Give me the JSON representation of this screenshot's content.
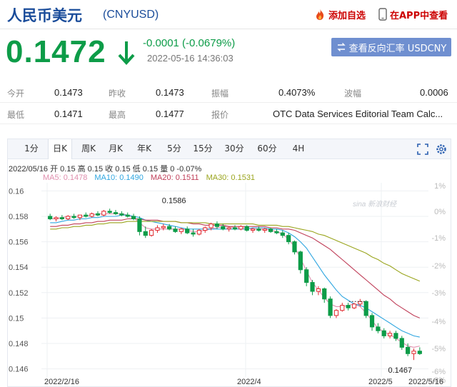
{
  "header": {
    "title": "人民币美元",
    "code": "(CNYUSD)",
    "favorite_label": "添加自选",
    "app_label": "在APP中查看"
  },
  "quote": {
    "price": "0.1472",
    "change": "-0.0001 (-0.0679%)",
    "time": "2022-05-16 14:36:03",
    "reverse_label": "查看反向汇率 USDCNY"
  },
  "stats": {
    "open_label": "今开",
    "open": "0.1473",
    "prev_close_label": "昨收",
    "prev_close": "0.1473",
    "amplitude_label": "振幅",
    "amplitude": "0.4073%",
    "wave_label": "波幅",
    "wave": "0.0006",
    "low_label": "最低",
    "low": "0.1471",
    "high_label": "最高",
    "high": "0.1477",
    "quote_label": "报价",
    "quote_source": "OTC Data Services Editorial Team Calc..."
  },
  "chart_tabs": [
    {
      "label": "1分",
      "active": false
    },
    {
      "label": "日K",
      "active": true
    },
    {
      "label": "周K",
      "active": false
    },
    {
      "label": "月K",
      "active": false
    },
    {
      "label": "年K",
      "active": false
    },
    {
      "label": "5分",
      "active": false
    },
    {
      "label": "15分",
      "active": false
    },
    {
      "label": "30分",
      "active": false
    },
    {
      "label": "60分",
      "active": false
    },
    {
      "label": "4H",
      "active": false
    }
  ],
  "info_line": "2022/05/16 开 0.15 高 0.15 收 0.15 低 0.15 量 0 -0.07%",
  "ma_legend": [
    {
      "label": "MA5: 0.1478",
      "color": "#e08fae"
    },
    {
      "label": "MA10: 0.1490",
      "color": "#2fa6e0"
    },
    {
      "label": "MA20: 0.1511",
      "color": "#c0405a"
    },
    {
      "label": "MA30: 0.1531",
      "color": "#9aa51e"
    }
  ],
  "watermark": "sina 新浪财经",
  "colors": {
    "accent": "#1a4c9a",
    "down": "#0d9c48",
    "up": "#e0282e",
    "button": "#6f8fd0"
  },
  "icons": {
    "favorite": "fire-icon",
    "app": "phone-icon",
    "reverse": "swap-icon",
    "fullscreen": "fullscreen-icon",
    "settings": "settings-icon"
  },
  "chart_data": {
    "type": "candlestick",
    "y_ticks": [
      "0.16",
      "0.158",
      "0.156",
      "0.154",
      "0.152",
      "0.15",
      "0.148",
      "0.146"
    ],
    "y_right_ticks": [
      "1%",
      "0%",
      "-1%",
      "-2%",
      "-3%",
      "-4%",
      "-5%",
      "-6%",
      "-8%"
    ],
    "x_labels": [
      "2022/2/16",
      "2022/4",
      "2022/5",
      "2022/5/16"
    ],
    "ylim": [
      0.1457,
      0.1603
    ],
    "annotations": [
      {
        "label": "0.1586",
        "index": 19,
        "value": 0.1586
      },
      {
        "label": "0.1467",
        "index": 61,
        "value": 0.1467
      }
    ],
    "candles": [
      {
        "o": 0.158,
        "h": 0.1582,
        "l": 0.1577,
        "c": 0.1578
      },
      {
        "o": 0.1578,
        "h": 0.158,
        "l": 0.1576,
        "c": 0.1579
      },
      {
        "o": 0.1579,
        "h": 0.1581,
        "l": 0.1577,
        "c": 0.1578
      },
      {
        "o": 0.1578,
        "h": 0.1581,
        "l": 0.1577,
        "c": 0.158
      },
      {
        "o": 0.158,
        "h": 0.1582,
        "l": 0.1578,
        "c": 0.1579
      },
      {
        "o": 0.1579,
        "h": 0.1581,
        "l": 0.1577,
        "c": 0.1581
      },
      {
        "o": 0.1581,
        "h": 0.1583,
        "l": 0.1579,
        "c": 0.158
      },
      {
        "o": 0.158,
        "h": 0.1583,
        "l": 0.1579,
        "c": 0.1582
      },
      {
        "o": 0.1582,
        "h": 0.1584,
        "l": 0.158,
        "c": 0.1581
      },
      {
        "o": 0.1581,
        "h": 0.1585,
        "l": 0.158,
        "c": 0.1584
      },
      {
        "o": 0.1584,
        "h": 0.1586,
        "l": 0.1582,
        "c": 0.1583
      },
      {
        "o": 0.1583,
        "h": 0.1585,
        "l": 0.1581,
        "c": 0.1582
      },
      {
        "o": 0.1582,
        "h": 0.1584,
        "l": 0.158,
        "c": 0.1581
      },
      {
        "o": 0.1581,
        "h": 0.1583,
        "l": 0.1579,
        "c": 0.158
      },
      {
        "o": 0.158,
        "h": 0.1582,
        "l": 0.1577,
        "c": 0.1578
      },
      {
        "o": 0.1578,
        "h": 0.158,
        "l": 0.1565,
        "c": 0.1568
      },
      {
        "o": 0.1568,
        "h": 0.1572,
        "l": 0.1563,
        "c": 0.1565
      },
      {
        "o": 0.1565,
        "h": 0.157,
        "l": 0.1564,
        "c": 0.1569
      },
      {
        "o": 0.1569,
        "h": 0.1573,
        "l": 0.1567,
        "c": 0.1571
      },
      {
        "o": 0.1571,
        "h": 0.1574,
        "l": 0.1569,
        "c": 0.1572
      },
      {
        "o": 0.1572,
        "h": 0.1574,
        "l": 0.1569,
        "c": 0.157
      },
      {
        "o": 0.157,
        "h": 0.1572,
        "l": 0.1567,
        "c": 0.1568
      },
      {
        "o": 0.1568,
        "h": 0.1571,
        "l": 0.1566,
        "c": 0.157
      },
      {
        "o": 0.157,
        "h": 0.1572,
        "l": 0.1566,
        "c": 0.1567
      },
      {
        "o": 0.1567,
        "h": 0.157,
        "l": 0.1564,
        "c": 0.1566
      },
      {
        "o": 0.1566,
        "h": 0.157,
        "l": 0.1565,
        "c": 0.1569
      },
      {
        "o": 0.1569,
        "h": 0.1572,
        "l": 0.1567,
        "c": 0.1571
      },
      {
        "o": 0.1571,
        "h": 0.1575,
        "l": 0.1569,
        "c": 0.1574
      },
      {
        "o": 0.1574,
        "h": 0.1576,
        "l": 0.157,
        "c": 0.1572
      },
      {
        "o": 0.1572,
        "h": 0.1574,
        "l": 0.1569,
        "c": 0.157
      },
      {
        "o": 0.157,
        "h": 0.1572,
        "l": 0.1568,
        "c": 0.1571
      },
      {
        "o": 0.1571,
        "h": 0.1573,
        "l": 0.1569,
        "c": 0.157
      },
      {
        "o": 0.157,
        "h": 0.1573,
        "l": 0.1569,
        "c": 0.1572
      },
      {
        "o": 0.1572,
        "h": 0.1573,
        "l": 0.1568,
        "c": 0.1569
      },
      {
        "o": 0.1569,
        "h": 0.1571,
        "l": 0.1567,
        "c": 0.157
      },
      {
        "o": 0.157,
        "h": 0.1572,
        "l": 0.1568,
        "c": 0.1569
      },
      {
        "o": 0.1569,
        "h": 0.1571,
        "l": 0.1567,
        "c": 0.157
      },
      {
        "o": 0.157,
        "h": 0.1571,
        "l": 0.1567,
        "c": 0.1568
      },
      {
        "o": 0.1568,
        "h": 0.157,
        "l": 0.1566,
        "c": 0.1567
      },
      {
        "o": 0.1567,
        "h": 0.1569,
        "l": 0.1563,
        "c": 0.1565
      },
      {
        "o": 0.1565,
        "h": 0.1567,
        "l": 0.1558,
        "c": 0.156
      },
      {
        "o": 0.156,
        "h": 0.1561,
        "l": 0.155,
        "c": 0.1552
      },
      {
        "o": 0.1552,
        "h": 0.1553,
        "l": 0.1535,
        "c": 0.1538
      },
      {
        "o": 0.1538,
        "h": 0.154,
        "l": 0.1525,
        "c": 0.1528
      },
      {
        "o": 0.1528,
        "h": 0.153,
        "l": 0.1518,
        "c": 0.1521
      },
      {
        "o": 0.1521,
        "h": 0.1525,
        "l": 0.1518,
        "c": 0.1523
      },
      {
        "o": 0.1523,
        "h": 0.1524,
        "l": 0.1512,
        "c": 0.1515
      },
      {
        "o": 0.1515,
        "h": 0.1517,
        "l": 0.15,
        "c": 0.1502
      },
      {
        "o": 0.1502,
        "h": 0.1507,
        "l": 0.15,
        "c": 0.1506
      },
      {
        "o": 0.1506,
        "h": 0.1512,
        "l": 0.1505,
        "c": 0.151
      },
      {
        "o": 0.151,
        "h": 0.1512,
        "l": 0.1506,
        "c": 0.1508
      },
      {
        "o": 0.1508,
        "h": 0.1512,
        "l": 0.1507,
        "c": 0.1511
      },
      {
        "o": 0.1511,
        "h": 0.1515,
        "l": 0.1509,
        "c": 0.1513
      },
      {
        "o": 0.1513,
        "h": 0.1514,
        "l": 0.15,
        "c": 0.1502
      },
      {
        "o": 0.1502,
        "h": 0.1504,
        "l": 0.149,
        "c": 0.1493
      },
      {
        "o": 0.1493,
        "h": 0.1496,
        "l": 0.1488,
        "c": 0.149
      },
      {
        "o": 0.149,
        "h": 0.1492,
        "l": 0.1484,
        "c": 0.1486
      },
      {
        "o": 0.1486,
        "h": 0.149,
        "l": 0.1484,
        "c": 0.1488
      },
      {
        "o": 0.1488,
        "h": 0.149,
        "l": 0.1482,
        "c": 0.1484
      },
      {
        "o": 0.1484,
        "h": 0.1486,
        "l": 0.1475,
        "c": 0.1477
      },
      {
        "o": 0.1477,
        "h": 0.148,
        "l": 0.147,
        "c": 0.1472
      },
      {
        "o": 0.1472,
        "h": 0.1476,
        "l": 0.1467,
        "c": 0.1474
      },
      {
        "o": 0.1474,
        "h": 0.1477,
        "l": 0.1471,
        "c": 0.1472
      }
    ],
    "ma": [
      {
        "name": "MA5",
        "color": "#e08fae",
        "values": [
          0.1578,
          0.1578,
          0.1579,
          0.158,
          0.158,
          0.158,
          0.158,
          0.1581,
          0.1582,
          0.1582,
          0.1582,
          0.1582,
          0.1582,
          0.1581,
          0.1579,
          0.1575,
          0.1571,
          0.157,
          0.157,
          0.157,
          0.157,
          0.157,
          0.157,
          0.1569,
          0.1568,
          0.1568,
          0.1569,
          0.157,
          0.1571,
          0.1572,
          0.1572,
          0.1571,
          0.1571,
          0.1571,
          0.157,
          0.157,
          0.157,
          0.1569,
          0.1568,
          0.1566,
          0.1562,
          0.1556,
          0.1547,
          0.1537,
          0.1528,
          0.1522,
          0.1516,
          0.1511,
          0.1509,
          0.1509,
          0.151,
          0.1511,
          0.1509,
          0.1504,
          0.1498,
          0.1492,
          0.1489,
          0.1487,
          0.1484,
          0.1481,
          0.1478,
          0.1477,
          0.1478
        ]
      },
      {
        "name": "MA10",
        "color": "#2fa6e0",
        "values": [
          0.1575,
          0.1575,
          0.1576,
          0.1577,
          0.1577,
          0.1578,
          0.1578,
          0.1579,
          0.1579,
          0.158,
          0.158,
          0.158,
          0.1581,
          0.1581,
          0.158,
          0.1579,
          0.1577,
          0.1576,
          0.1575,
          0.1574,
          0.1573,
          0.1572,
          0.1571,
          0.157,
          0.157,
          0.157,
          0.157,
          0.157,
          0.157,
          0.157,
          0.157,
          0.157,
          0.157,
          0.157,
          0.1571,
          0.1571,
          0.1571,
          0.157,
          0.157,
          0.1569,
          0.1567,
          0.1564,
          0.156,
          0.1555,
          0.1548,
          0.1541,
          0.1534,
          0.1528,
          0.1522,
          0.1517,
          0.1514,
          0.1511,
          0.151,
          0.1508,
          0.1505,
          0.1502,
          0.1499,
          0.1496,
          0.1493,
          0.149,
          0.1488,
          0.1486,
          0.1485
        ]
      },
      {
        "name": "MA20",
        "color": "#c0405a",
        "values": [
          0.1572,
          0.1572,
          0.1573,
          0.1573,
          0.1574,
          0.1574,
          0.1575,
          0.1575,
          0.1576,
          0.1576,
          0.1577,
          0.1577,
          0.1577,
          0.1578,
          0.1578,
          0.1578,
          0.1577,
          0.1577,
          0.1577,
          0.1576,
          0.1576,
          0.1576,
          0.1575,
          0.1575,
          0.1574,
          0.1574,
          0.1573,
          0.1573,
          0.1573,
          0.1573,
          0.1572,
          0.1572,
          0.1572,
          0.1572,
          0.1572,
          0.1572,
          0.1572,
          0.1571,
          0.1571,
          0.157,
          0.157,
          0.1569,
          0.1567,
          0.1565,
          0.1563,
          0.156,
          0.1557,
          0.1554,
          0.155,
          0.1546,
          0.1542,
          0.1538,
          0.1534,
          0.153,
          0.1526,
          0.1522,
          0.1518,
          0.1515,
          0.1511,
          0.1508,
          0.1505,
          0.1502,
          0.15
        ]
      },
      {
        "name": "MA30",
        "color": "#9aa51e",
        "values": [
          0.157,
          0.157,
          0.1571,
          0.1571,
          0.1572,
          0.1572,
          0.1573,
          0.1573,
          0.1574,
          0.1574,
          0.1575,
          0.1575,
          0.1575,
          0.1576,
          0.1576,
          0.1576,
          0.1576,
          0.1576,
          0.1576,
          0.1576,
          0.1576,
          0.1576,
          0.1575,
          0.1575,
          0.1575,
          0.1575,
          0.1575,
          0.1574,
          0.1574,
          0.1574,
          0.1574,
          0.1574,
          0.1574,
          0.1574,
          0.1574,
          0.1573,
          0.1573,
          0.1573,
          0.1573,
          0.1572,
          0.1572,
          0.1571,
          0.157,
          0.1569,
          0.1568,
          0.1566,
          0.1565,
          0.1563,
          0.1561,
          0.1559,
          0.1557,
          0.1555,
          0.1553,
          0.1551,
          0.1548,
          0.1546,
          0.1543,
          0.1541,
          0.1538,
          0.1535,
          0.1533,
          0.1531,
          0.1529
        ]
      }
    ]
  }
}
